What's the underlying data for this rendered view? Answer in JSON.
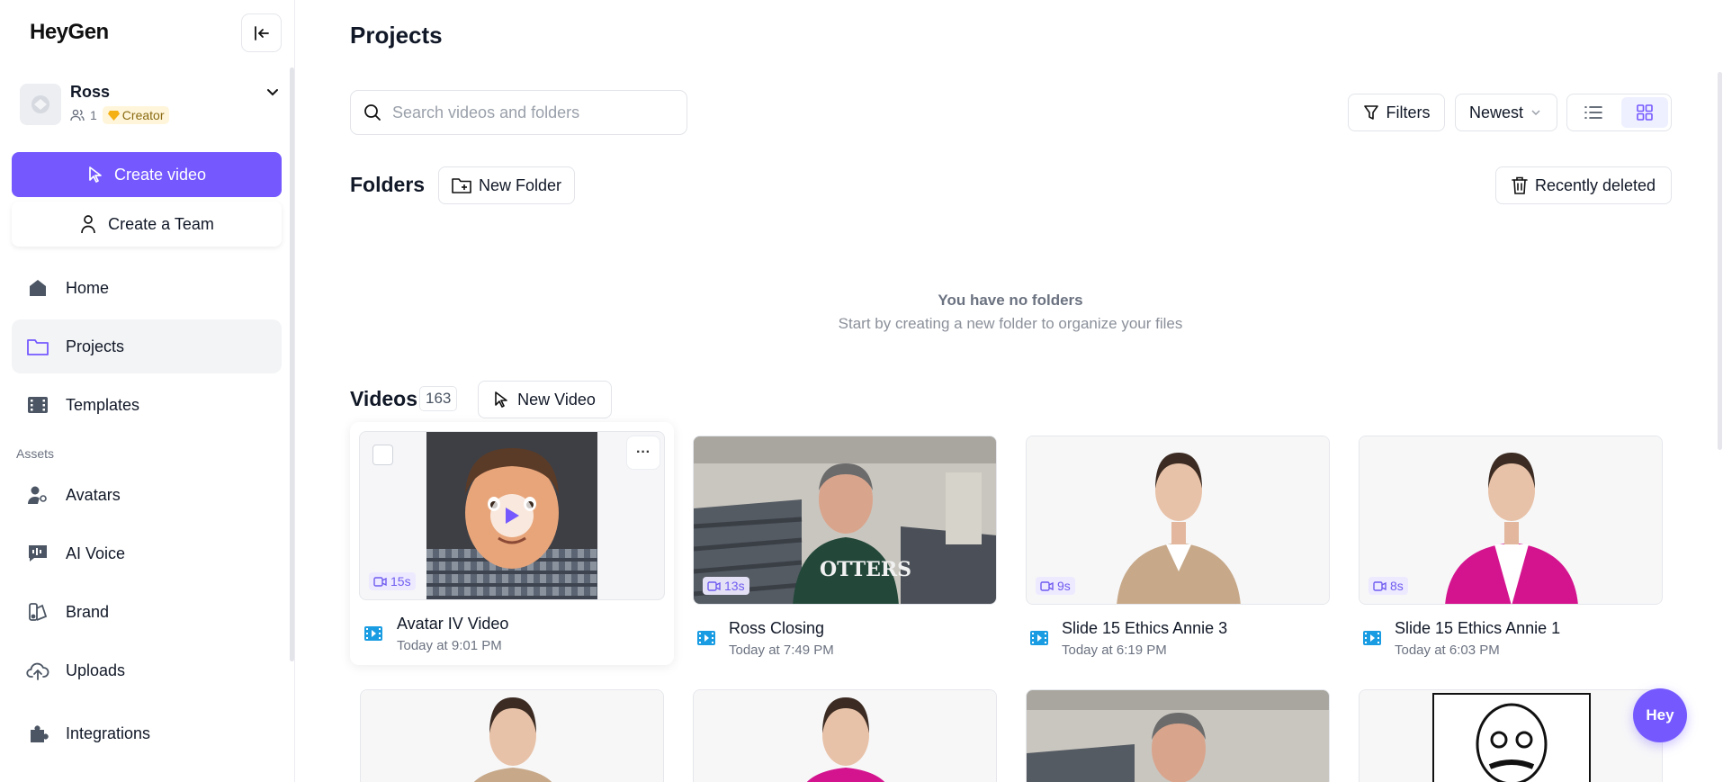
{
  "brand": {
    "logo": "HeyGen",
    "accent": "#7559ff"
  },
  "sidebar": {
    "user": {
      "name": "Ross",
      "members": "1",
      "plan": "Creator"
    },
    "create_video": "Create video",
    "create_team": "Create a Team",
    "nav": [
      {
        "label": "Home",
        "icon": "home-icon"
      },
      {
        "label": "Projects",
        "icon": "folder-icon",
        "active": true
      },
      {
        "label": "Templates",
        "icon": "film-icon"
      }
    ],
    "assets_label": "Assets",
    "assets": [
      {
        "label": "Avatars",
        "icon": "avatar-icon"
      },
      {
        "label": "AI Voice",
        "icon": "voice-icon"
      },
      {
        "label": "Brand",
        "icon": "brand-icon"
      },
      {
        "label": "Uploads",
        "icon": "upload-icon"
      },
      {
        "label": "Integrations",
        "icon": "puzzle-icon"
      }
    ]
  },
  "main": {
    "title": "Projects",
    "search_placeholder": "Search videos and folders",
    "filters": "Filters",
    "sort": "Newest",
    "folders": {
      "title": "Folders",
      "new_folder": "New Folder",
      "recently_deleted": "Recently deleted",
      "empty_title": "You have no folders",
      "empty_sub": "Start by creating a new folder to organize your files"
    },
    "videos": {
      "title": "Videos",
      "count": "163",
      "new_video": "New Video",
      "items": [
        {
          "title": "Avatar IV Video",
          "time": "Today at 9:01 PM",
          "duration": "15s"
        },
        {
          "title": "Ross Closing",
          "time": "Today at 7:49 PM",
          "duration": "13s"
        },
        {
          "title": "Slide 15 Ethics Annie 3",
          "time": "Today at 6:19 PM",
          "duration": "9s"
        },
        {
          "title": "Slide 15 Ethics Annie 1",
          "time": "Today at 6:03 PM",
          "duration": "8s"
        }
      ]
    },
    "more_label": "···"
  },
  "fab_label": "Hey"
}
